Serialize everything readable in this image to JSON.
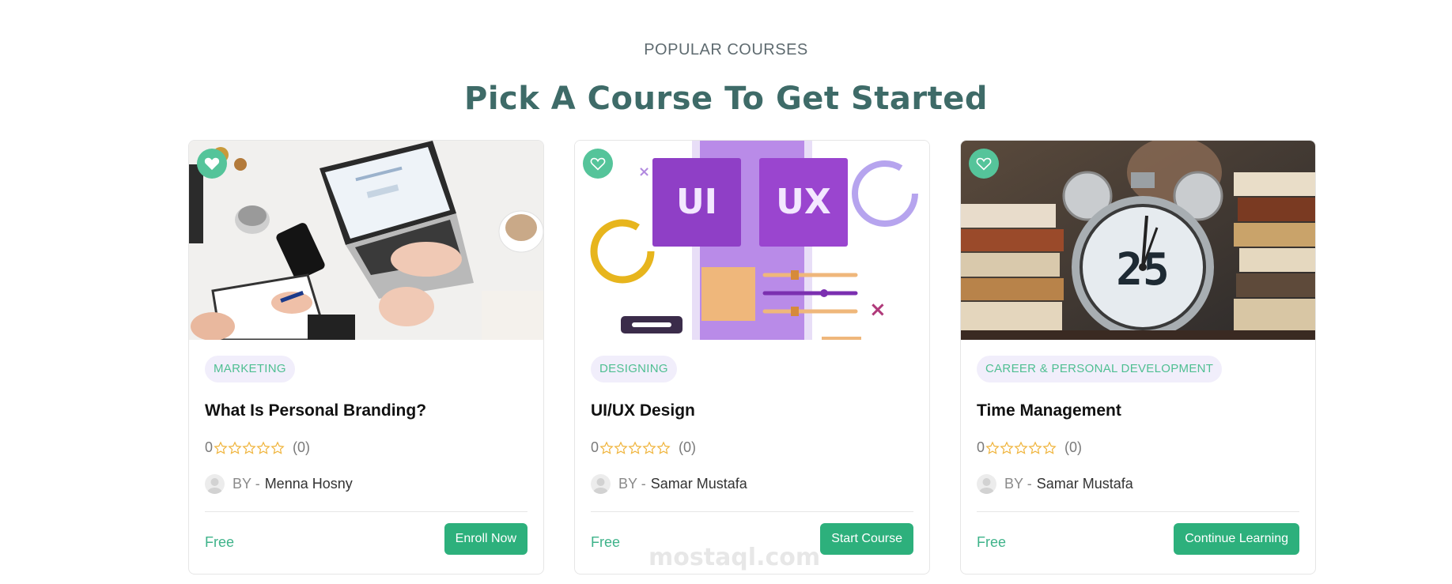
{
  "section": {
    "eyebrow": "POPULAR COURSES",
    "title": "Pick A Course To Get Started"
  },
  "courses": [
    {
      "category": "MARKETING",
      "title": "What Is Personal Branding?",
      "rating_value": "0",
      "rating_count": "(0)",
      "by_label": "BY -",
      "author": "Menna Hosny",
      "price": "Free",
      "button": "Enroll Now",
      "favorite_filled": true,
      "image_icon": "laptop-desk-photo"
    },
    {
      "category": "DESIGNING",
      "title": "UI/UX Design",
      "rating_value": "0",
      "rating_count": "(0)",
      "by_label": "BY -",
      "author": "Samar Mustafa",
      "price": "Free",
      "button": "Start Course",
      "favorite_filled": false,
      "image_icon": "ui-ux-illustration",
      "image_text": [
        "UI",
        "UX"
      ]
    },
    {
      "category": "CAREER & PERSONAL DEVELOPMENT",
      "title": "Time Management",
      "rating_value": "0",
      "rating_count": "(0)",
      "by_label": "BY -",
      "author": "Samar Mustafa",
      "price": "Free",
      "button": "Continue Learning",
      "favorite_filled": false,
      "image_icon": "alarm-clock-books-photo",
      "image_text": [
        "25"
      ]
    }
  ],
  "watermark": "mostaql.com",
  "colors": {
    "accent": "#2db07c",
    "heading": "#3e6b68",
    "badge_bg": "#f1eefb",
    "star": "#f0b43c"
  }
}
